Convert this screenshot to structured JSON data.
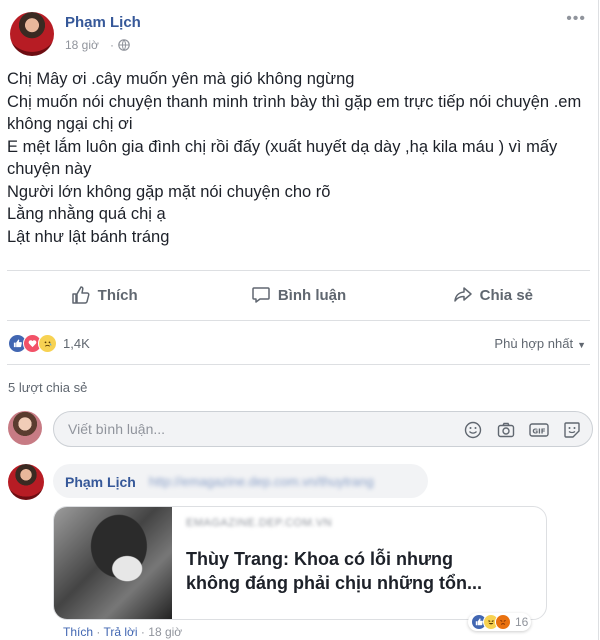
{
  "post": {
    "author": "Phạm Lịch",
    "time": "18 giờ",
    "separator": "·",
    "more_label": "•••",
    "lines": [
      "Chị Mây ơi .cây muốn yên mà gió không ngừng",
      "Chị muốn nói chuyện thanh minh trình bày thì gặp em trực tiếp nói chuyện .em",
      "không ngại chị ơi",
      "E mệt lắm luôn gia đình chị rồi đấy (xuất huyết dạ dày ,hạ kila máu ) vì mấy",
      "chuyện này",
      "Người lớn không gặp mặt nói chuyện cho rõ",
      "Lằng nhằng quá chị ạ",
      "Lật như lật bánh tráng"
    ]
  },
  "actions": {
    "like": "Thích",
    "comment": "Bình luận",
    "share": "Chia sẻ"
  },
  "reactions": {
    "count": "1,4K",
    "sort_label": "Phù hợp nhất",
    "shares": "5 lượt chia sẻ"
  },
  "composer": {
    "placeholder": "Viết bình luận..."
  },
  "comment": {
    "author": "Phạm Lịch",
    "link": "http://emagazine.dep.com.vn/thuytrang",
    "preview": {
      "domain": "EMAGAZINE.DEP.COM.VN",
      "title_line1": "Thùy Trang: Khoa có lỗi nhưng",
      "title_line2": "không đáng phải chịu những tổn..."
    },
    "like_label": "Thích",
    "reply_label": "Trả lời",
    "time": "18 giờ",
    "reaction_count": "16"
  },
  "colors": {
    "link_blue": "#365899",
    "like_blue": "#4267b2",
    "love_red": "#f25268",
    "muted": "#90949c"
  }
}
